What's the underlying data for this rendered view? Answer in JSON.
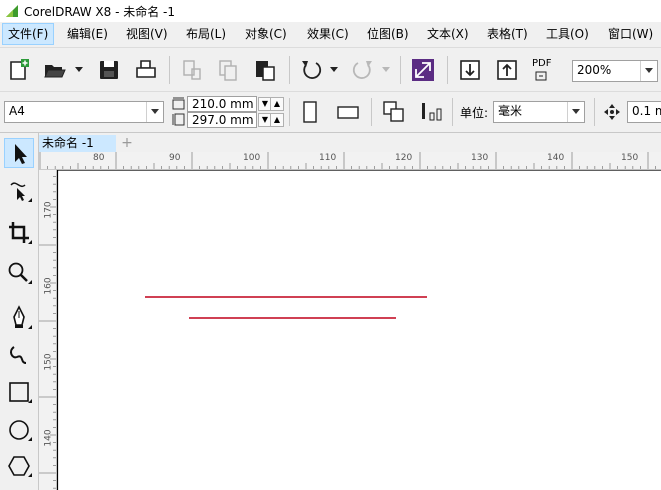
{
  "window": {
    "title": "CorelDRAW X8 - 未命名 -1"
  },
  "menu": [
    {
      "label": "文件(F)"
    },
    {
      "label": "编辑(E)"
    },
    {
      "label": "视图(V)"
    },
    {
      "label": "布局(L)"
    },
    {
      "label": "对象(C)"
    },
    {
      "label": "效果(C)"
    },
    {
      "label": "位图(B)"
    },
    {
      "label": "文本(X)"
    },
    {
      "label": "表格(T)"
    },
    {
      "label": "工具(O)"
    },
    {
      "label": "窗口(W)"
    }
  ],
  "toolbar": {
    "zoom_value": "200%",
    "pdf_label": "PDF"
  },
  "property_bar": {
    "page_size": "A4",
    "width": "210.0 mm",
    "height": "297.0 mm",
    "units_label": "单位:",
    "units_value": "毫米",
    "nudge": "0.1 m"
  },
  "document_tab": {
    "label": "未命名 -1",
    "add_label": "+"
  },
  "ruler_top": [
    "80",
    "90",
    "100",
    "110",
    "120",
    "130",
    "140",
    "150"
  ],
  "ruler_left": [
    "170",
    "160",
    "150",
    "140"
  ],
  "colors": {
    "line": "#c0001a",
    "accent_tab": "#cce8ff",
    "toolbar_bg": "#f0f0f0"
  }
}
